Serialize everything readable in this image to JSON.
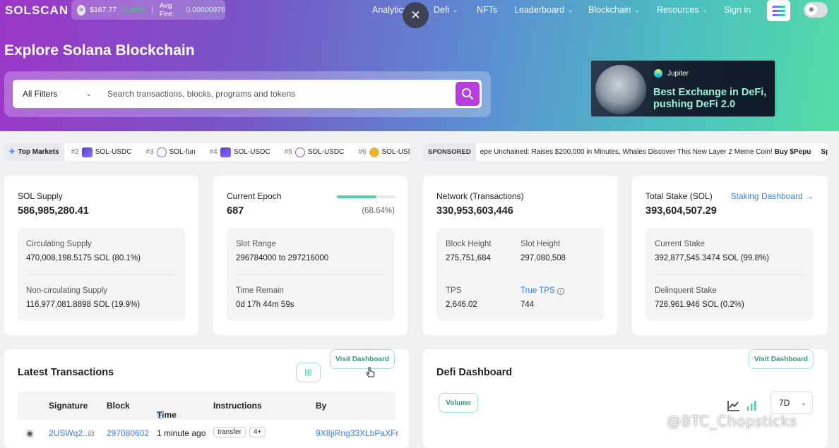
{
  "brand": {
    "logo": "SOLSCAN"
  },
  "price": {
    "value": "$167.77",
    "change": "+2.58%",
    "fee_label": "Avg Fee:",
    "fee_value": "0.00000976"
  },
  "nav": {
    "analytics": "Analytics",
    "defi": "Defi",
    "nfts": "NFTs",
    "leaderboard": "Leaderboard",
    "blockchain": "Blockchain",
    "resources": "Resources",
    "signin": "Sign in"
  },
  "hero": {
    "title": "Explore Solana Blockchain"
  },
  "search": {
    "filter": "All Filters",
    "placeholder": "Search transactions, blocks, programs and tokens"
  },
  "banner": {
    "brand": "Jupiter",
    "line1": "Best Exchange in DeFi,",
    "line2": "pushing DeFi 2.0"
  },
  "ticker": {
    "label": "Top Markets",
    "items": [
      {
        "rank": "#2",
        "name": "SOL-USDC"
      },
      {
        "rank": "#3",
        "name": "SOL-fun"
      },
      {
        "rank": "#4",
        "name": "SOL-USDC"
      },
      {
        "rank": "#5",
        "name": "SOL-USDC"
      },
      {
        "rank": "#6",
        "name": "SOL-USD"
      }
    ]
  },
  "sponsored": {
    "label": "SPONSORED",
    "message": "epe Unchained: Raises $200,000 in Minutes, Whales Discover This New Layer 2 Meme Coin!",
    "cta": "Buy $Pepu",
    "next": "Spor"
  },
  "supply": {
    "label": "SOL Supply",
    "value": "586,985,280.41",
    "circ_label": "Circulating Supply",
    "circ_value": "470,008,198.5175 SOL (80.1%)",
    "noncirc_label": "Non-circulating Supply",
    "noncirc_value": "116,977,081.8898 SOL (19.9%)"
  },
  "epoch": {
    "label": "Current Epoch",
    "value": "687",
    "percent": "(68.64%)",
    "progress": 0.6864,
    "slot_label": "Slot Range",
    "slot_value": "296784000 to 297216000",
    "remain_label": "Time Remain",
    "remain_value": "0d 17h 44m 59s"
  },
  "network": {
    "label": "Network (Transactions)",
    "value": "330,953,603,446",
    "bh_label": "Block Height",
    "bh_value": "275,751,684",
    "sh_label": "Slot Height",
    "sh_value": "297,080,508",
    "tps_label": "TPS",
    "tps_value": "2,646.02",
    "ttps_label": "True TPS",
    "ttps_value": "744"
  },
  "stake": {
    "label": "Total Stake (SOL)",
    "value": "393,604,507.29",
    "link": "Staking Dashboard",
    "cur_label": "Current Stake",
    "cur_value": "392,877,545.3474 SOL (99.8%)",
    "del_label": "Delinquent Stake",
    "del_value": "726,961.946 SOL (0.2%)"
  },
  "transactions": {
    "title": "Latest Transactions",
    "visit": "Visit Dashboard",
    "headers": {
      "signature": "Signature",
      "block": "Block",
      "time": "Time",
      "instructions": "Instructions",
      "by": "By"
    },
    "row": {
      "signature": "2USWq2...",
      "block": "297080602",
      "time": "1 minute ago",
      "instr": "transfer",
      "more": "4+",
      "by": "9X8jiRng33XLbPaXFr"
    }
  },
  "defi": {
    "title": "Defi Dashboard",
    "visit": "Visit Dashboard",
    "volume": "Volume",
    "range": "7D"
  },
  "watermark": "@BTC_Chopsticks",
  "colors": {
    "accent": "#4fcf9e",
    "link": "#3a7ee8",
    "search_btn": "#b73edb"
  }
}
